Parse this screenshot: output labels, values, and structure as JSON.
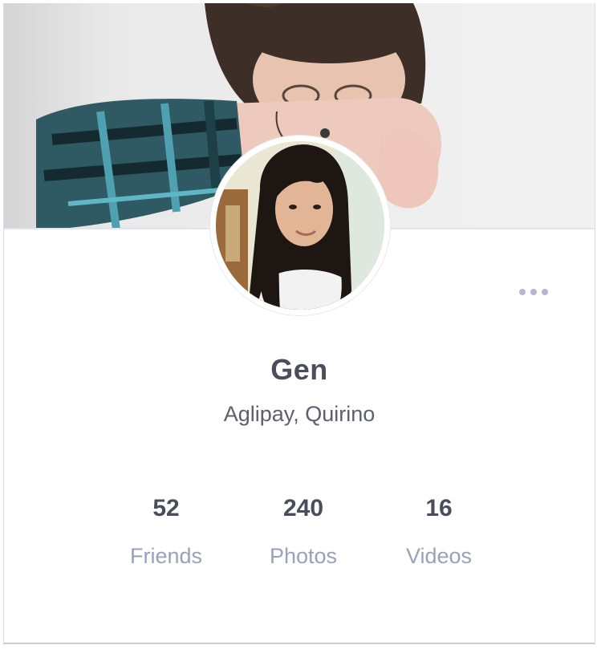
{
  "profile": {
    "name": "Gen",
    "location": "Aglipay, Quirino"
  },
  "stats": [
    {
      "value": "52",
      "label": "Friends"
    },
    {
      "value": "240",
      "label": "Photos"
    },
    {
      "value": "16",
      "label": "Videos"
    }
  ],
  "icons": {
    "more": "more-horizontal-icon"
  },
  "colors": {
    "name_text": "#4a4e5c",
    "label_text": "#9ba0bb",
    "more_dots": "#b3b8cf"
  }
}
